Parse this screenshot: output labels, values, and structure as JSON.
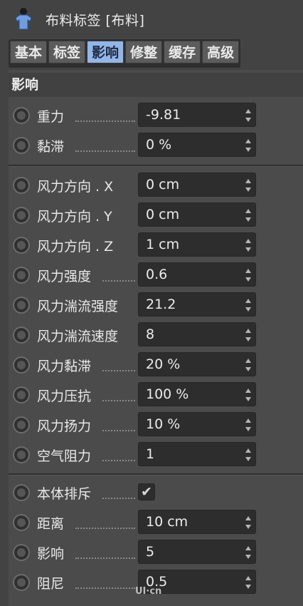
{
  "header": {
    "title": "布料标签 [布料]",
    "icon": "cloth-tag-icon"
  },
  "tabs": [
    {
      "label": "基本",
      "active": false
    },
    {
      "label": "标签",
      "active": false
    },
    {
      "label": "影响",
      "active": true
    },
    {
      "label": "修整",
      "active": false
    },
    {
      "label": "缓存",
      "active": false
    },
    {
      "label": "高级",
      "active": false
    }
  ],
  "section": {
    "title": "影响"
  },
  "params": {
    "gravity": {
      "label": "重力",
      "value": "-9.81"
    },
    "drag": {
      "label": "黏滞",
      "value": "0 %"
    },
    "wind_x": {
      "label": "风力方向 . X",
      "value": "0 cm"
    },
    "wind_y": {
      "label": "风力方向 . Y",
      "value": "0 cm"
    },
    "wind_z": {
      "label": "风力方向 . Z",
      "value": "1 cm"
    },
    "wind_strength": {
      "label": "风力强度",
      "value": "0.6"
    },
    "wind_turb_strength": {
      "label": "风力湍流强度",
      "value": "21.2"
    },
    "wind_turb_speed": {
      "label": "风力湍流速度",
      "value": "8"
    },
    "wind_drag": {
      "label": "风力黏滞",
      "value": "20 %"
    },
    "wind_pressure": {
      "label": "风力压抗",
      "value": "100 %"
    },
    "wind_lift": {
      "label": "风力扬力",
      "value": "10 %"
    },
    "air_resistance": {
      "label": "空气阻力",
      "value": "1"
    },
    "self_repulsion": {
      "label": "本体排斥",
      "checked": true
    },
    "distance": {
      "label": "距离",
      "value": "10 cm"
    },
    "force": {
      "label": "影响",
      "value": "5"
    },
    "damping": {
      "label": "阻尼",
      "value": "0.5"
    }
  },
  "watermark": {
    "text": "UI·cn"
  },
  "colors": {
    "active_tab": "#93b6e7",
    "background": "#434343",
    "field": "#2d2d2d"
  }
}
